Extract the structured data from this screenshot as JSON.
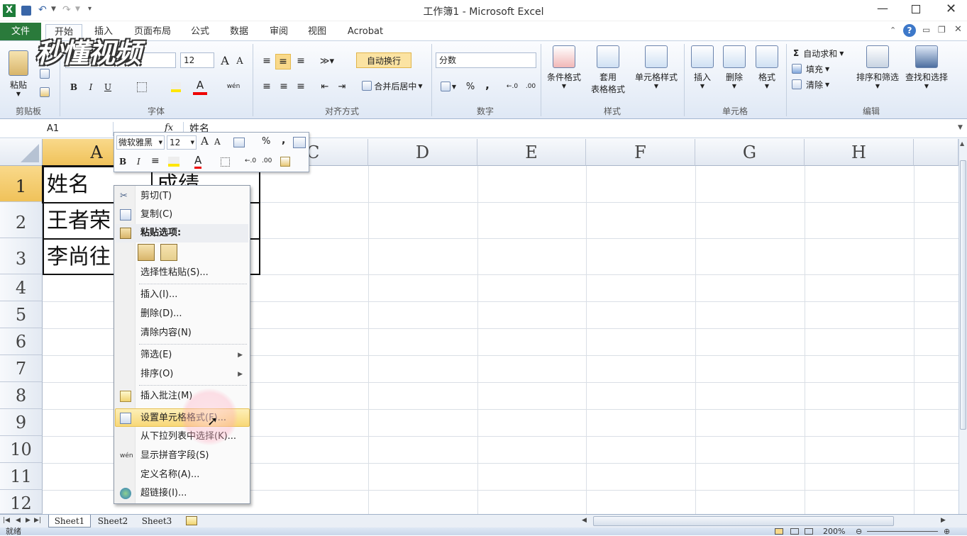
{
  "app": {
    "title": "工作簿1 - Microsoft Excel"
  },
  "tabs": [
    "文件",
    "开始",
    "插入",
    "页面布局",
    "公式",
    "数据",
    "审阅",
    "视图",
    "Acrobat"
  ],
  "watermark": "秒懂视频",
  "ribbon": {
    "clipboard": {
      "paste": "粘贴",
      "label": "剪贴板"
    },
    "font": {
      "name": "微软雅黑",
      "size": "12",
      "label": "字体",
      "bold": "B",
      "italic": "I",
      "underline": "U",
      "grow": "A",
      "shrink": "A",
      "font_color": "A",
      "pinyin": "wén"
    },
    "align": {
      "wrap": "自动换行",
      "merge": "合并后居中",
      "label": "对齐方式"
    },
    "number": {
      "format": "分数",
      "percent": "%",
      "comma": ",",
      "inc": "←.0\n.00",
      "dec": ".00\n→.0",
      "label": "数字"
    },
    "styles": {
      "cond": "条件格式",
      "table": "套用",
      "table2": "表格格式",
      "cell": "单元格样式",
      "label": "样式"
    },
    "cells": {
      "insert": "插入",
      "delete": "删除",
      "format": "格式",
      "label": "单元格"
    },
    "edit": {
      "autosum": "自动求和",
      "fill": "填充",
      "clear": "清除",
      "sort": "排序和筛选",
      "find": "查找和选择",
      "label": "编辑",
      "sigma": "Σ"
    }
  },
  "formula": {
    "namebox": "A1",
    "fx": "fx",
    "value": "姓名"
  },
  "columns": [
    "A",
    "B",
    "C",
    "D",
    "E",
    "F",
    "G",
    "H"
  ],
  "rows": [
    "1",
    "2",
    "3",
    "4",
    "5",
    "6",
    "7",
    "8",
    "9",
    "10",
    "11",
    "12"
  ],
  "cells": {
    "A1": "姓名",
    "B1": "成绩",
    "A2": "王者荣",
    "A3": "李尚往"
  },
  "minibar": {
    "font": "微软雅黑",
    "size": "12",
    "grow": "A",
    "shrink": "A",
    "percent": "%",
    "comma": ",",
    "bold": "B",
    "italic": "I",
    "font_color": "A"
  },
  "context_menu": {
    "cut": "剪切(T)",
    "copy": "复制(C)",
    "paste_options": "粘贴选项:",
    "paste_special": "选择性粘贴(S)...",
    "insert": "插入(I)...",
    "delete": "删除(D)...",
    "clear": "清除内容(N)",
    "filter": "筛选(E)",
    "sort": "排序(O)",
    "comment": "插入批注(M)",
    "format_cells": "设置单元格格式(F)...",
    "pick_list": "从下拉列表中选择(K)...",
    "phonetic": "显示拼音字段(S)",
    "define_name": "定义名称(A)...",
    "hyperlink": "超链接(I)..."
  },
  "sheets": [
    "Sheet1",
    "Sheet2",
    "Sheet3"
  ],
  "status": {
    "ready": "就绪",
    "zoom": "200%"
  },
  "colors": {
    "file_tab": "#2a7a3b",
    "selection": "#f3c86b",
    "highlight": "#f8d877"
  }
}
